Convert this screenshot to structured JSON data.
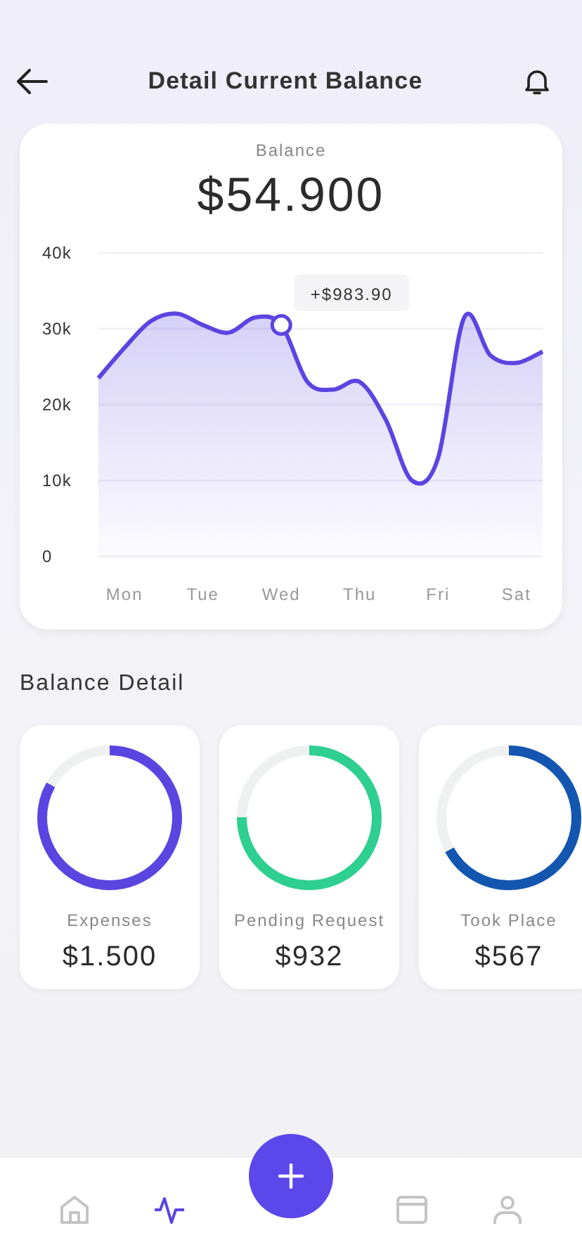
{
  "header": {
    "title": "Detail Current Balance"
  },
  "balance": {
    "label": "Balance",
    "amount": "$54.900",
    "chart_data": {
      "type": "area",
      "categories": [
        null,
        "Mon",
        null,
        null,
        "Tue",
        null,
        null,
        "Wed",
        null,
        null,
        "Thu",
        null,
        null,
        "Fri",
        null,
        null,
        "Sat",
        null
      ],
      "series": [
        {
          "color": "#5b45e0",
          "values": [
            23.5,
            27.5,
            31,
            32,
            30.5,
            29.5,
            31.5,
            30.5,
            23,
            22,
            23,
            18,
            10,
            13,
            31.5,
            26.5,
            25.5,
            27
          ]
        }
      ],
      "ylim": [
        0,
        40
      ],
      "grid": true,
      "yticks": [
        {
          "value": 0,
          "label": "0"
        },
        {
          "value": 10,
          "label": "10k"
        },
        {
          "value": 20,
          "label": "20k"
        },
        {
          "value": 30,
          "label": "30k"
        },
        {
          "value": 40,
          "label": "40k"
        }
      ],
      "annotations": [
        {
          "x": "Wed",
          "y": 30.5,
          "text": "+$983.90"
        }
      ]
    }
  },
  "detail_title": "Balance Detail",
  "details": [
    {
      "label": "Expenses",
      "amount": "$1.500",
      "level": 0.83,
      "color": "#5b45e0"
    },
    {
      "label": "Pending Request",
      "amount": "$932",
      "level": 0.75,
      "color": "#2ecf90"
    },
    {
      "label": "Took Place",
      "amount": "$567",
      "level": 0.67,
      "color": "#1356b0"
    }
  ],
  "nav": [
    {
      "kind": "home",
      "selected": false
    },
    {
      "kind": "activity",
      "selected": true
    },
    {
      "kind": "add",
      "selected": false
    },
    {
      "kind": "card",
      "selected": false
    },
    {
      "kind": "profile",
      "selected": false
    }
  ]
}
